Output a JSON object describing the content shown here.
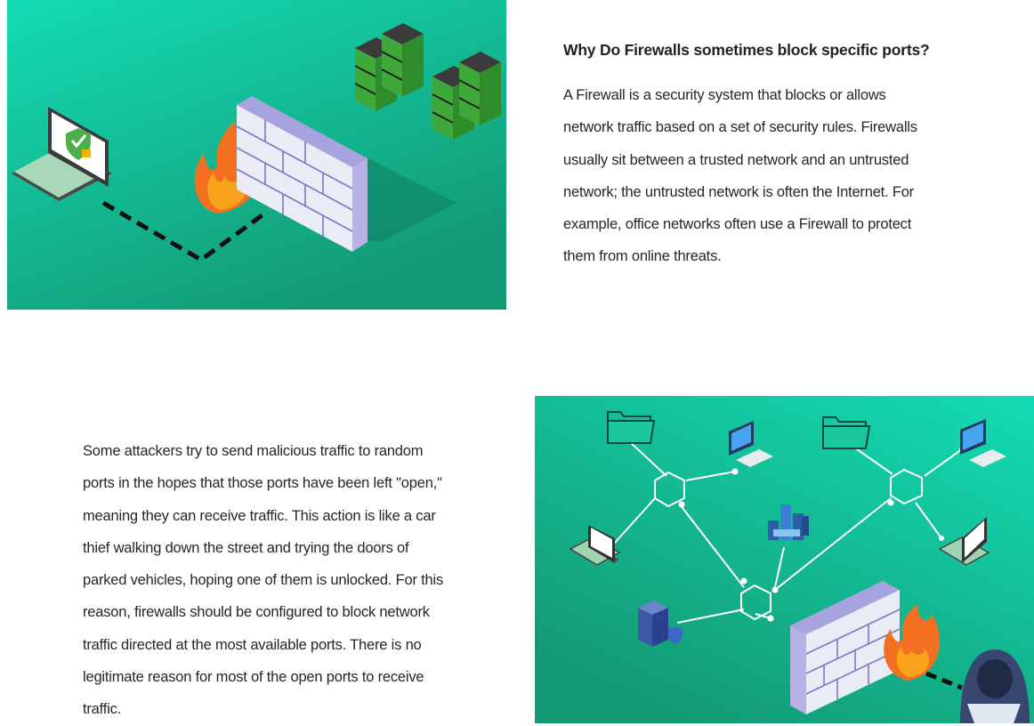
{
  "section1": {
    "heading": "Why Do Firewalls sometimes block specific ports?",
    "lines": [
      "A Firewall is a security system that blocks or allows",
      "network traffic based on a set of security rules. Firewalls",
      "usually sit between a trusted network and an untrusted",
      "network; the untrusted network is often the Internet. For",
      "example, office networks often use a Firewall to protect",
      "them from online threats."
    ]
  },
  "section2": {
    "lines": [
      "Some attackers try to send malicious traffic to random",
      "ports in the hopes that those ports have been left \"open,\"",
      "meaning they can receive traffic. This action is like a car",
      "thief walking down the street and trying the doors of",
      "parked vehicles, hoping one of them is unlocked. For this",
      "reason, firewalls should be configured to block network",
      "traffic directed at the most available ports. There is no",
      "legitimate reason for most of the open ports to receive",
      "traffic."
    ]
  },
  "colors": {
    "teal_light": "#13dcb4",
    "teal_dark": "#139a74",
    "wall_face": "#e8ecf4",
    "wall_top": "#a6a3de",
    "server_green": "#3fa83a",
    "flame": "#f37021",
    "hacker": "#37476f"
  },
  "icons": [
    "laptop-icon",
    "shield-icon",
    "firewall-icon",
    "flame-icon",
    "server-rack-icon",
    "folder-icon",
    "desktop-icon",
    "hub-icon",
    "datacenter-icon",
    "hacker-icon"
  ]
}
